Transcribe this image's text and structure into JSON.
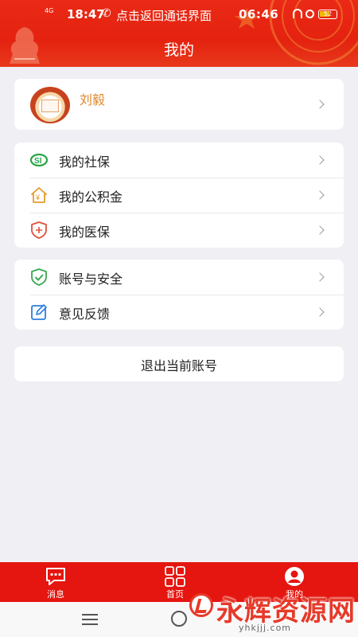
{
  "status_bar": {
    "network": "4G",
    "time": "18:47",
    "call_notice": "点击返回通话界面",
    "clock": "06:46",
    "battery": "52"
  },
  "header": {
    "title": "我的"
  },
  "profile": {
    "name": "刘毅"
  },
  "menu_group_1": [
    {
      "label": "我的社保",
      "icon": "social-security-icon"
    },
    {
      "label": "我的公积金",
      "icon": "housing-fund-icon"
    },
    {
      "label": "我的医保",
      "icon": "medical-insurance-icon"
    }
  ],
  "menu_group_2": [
    {
      "label": "账号与安全",
      "icon": "shield-check-icon"
    },
    {
      "label": "意见反馈",
      "icon": "edit-icon"
    }
  ],
  "logout_label": "退出当前账号",
  "tabbar": [
    {
      "label": "消息",
      "icon": "message-icon"
    },
    {
      "label": "首页",
      "icon": "grid-icon"
    },
    {
      "label": "我的",
      "icon": "user-icon"
    }
  ],
  "watermark": {
    "text": "永辉资源网",
    "url": "yhkjjj.com"
  },
  "colors": {
    "primary_red": "#e4220f",
    "profile_name": "#e0882a",
    "background": "#efeff4"
  }
}
